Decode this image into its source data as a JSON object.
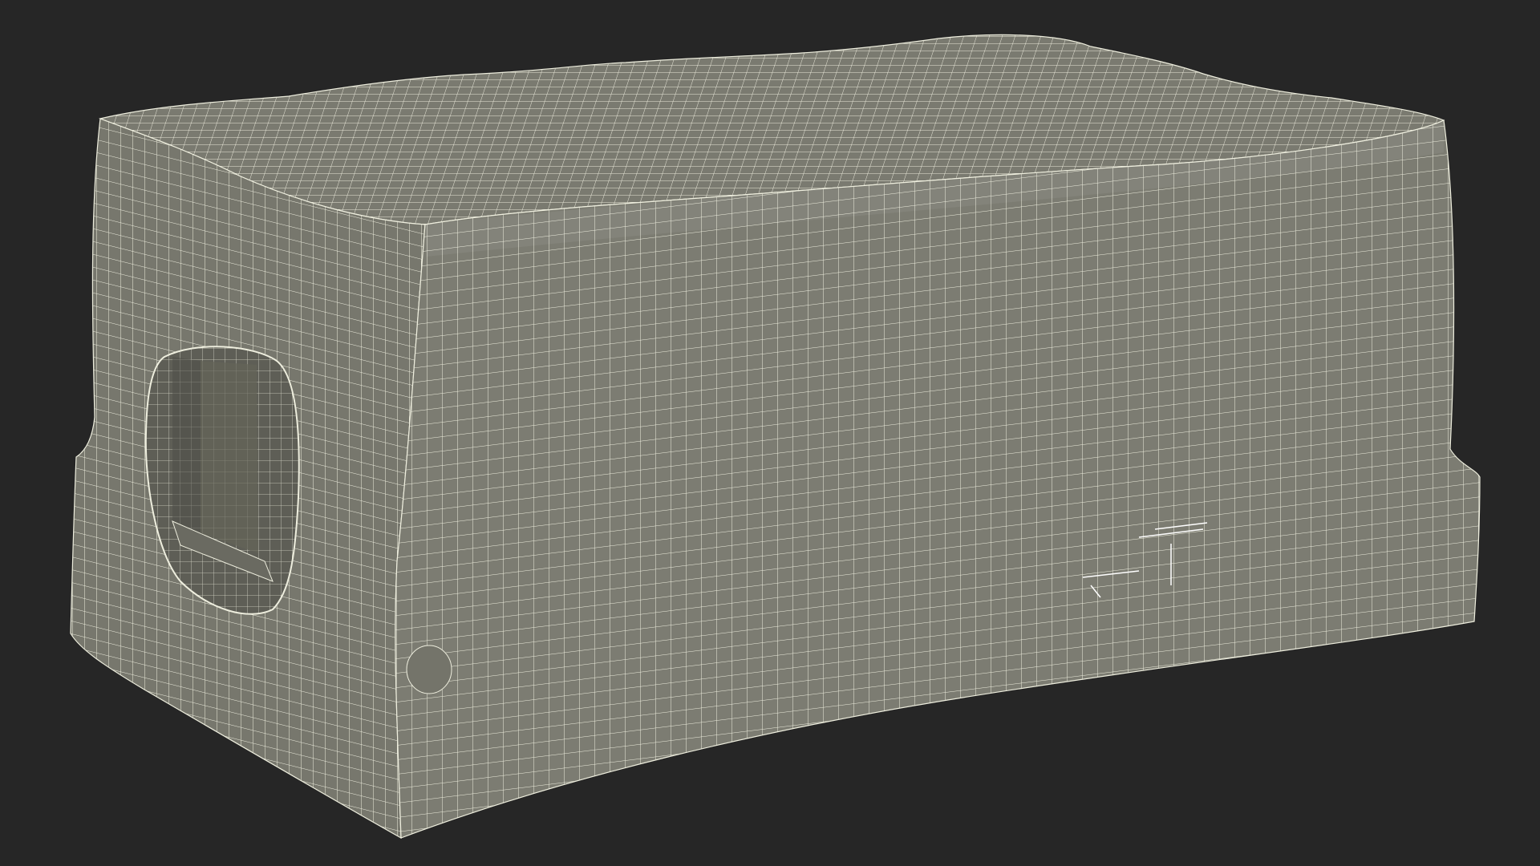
{
  "scene": {
    "subject": "wireframe-render",
    "colors": {
      "background": "#262626",
      "surface": "#7c7c72",
      "surface_dark": "#6e6e65",
      "wire": "#eeeede",
      "hole_interior": "#5b5b53"
    }
  }
}
